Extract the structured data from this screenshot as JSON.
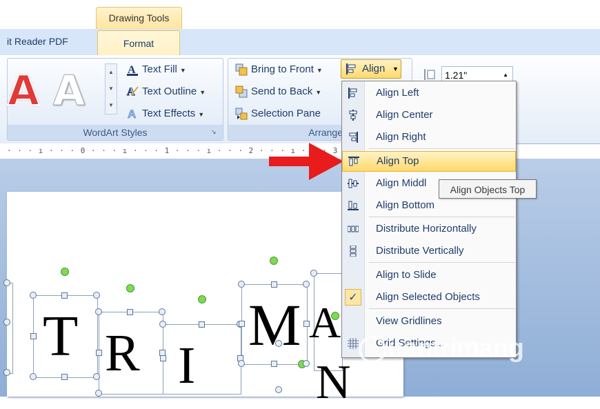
{
  "ribbon": {
    "contextual_tab": "Drawing Tools",
    "tabs": [
      "it Reader PDF",
      "Format"
    ],
    "wordart_group": {
      "label": "WordArt Styles",
      "items": [
        "Text Fill",
        "Text Outline",
        "Text Effects"
      ]
    },
    "arrange_group": {
      "label": "Arrange",
      "items": [
        "Bring to Front",
        "Send to Back",
        "Selection Pane"
      ],
      "align_button": "Align"
    },
    "size_value": "1.21\""
  },
  "ruler_text": "· · · ı · · · 0 · · · ı · · · 1 · · · ı · · · 2 · · · ı · · · 3",
  "letters": [
    "T",
    "R",
    "I",
    "M",
    "A",
    "N"
  ],
  "align_menu": {
    "items": [
      {
        "label": "Align Left",
        "icon": "align-left-icon"
      },
      {
        "label": "Align Center",
        "icon": "align-center-icon"
      },
      {
        "label": "Align Right",
        "icon": "align-right-icon"
      },
      {
        "label": "Align Top",
        "icon": "align-top-icon",
        "highlighted": true
      },
      {
        "label": "Align Middle",
        "icon": "align-middle-icon"
      },
      {
        "label": "Align Bottom",
        "icon": "align-bottom-icon"
      },
      {
        "label": "Distribute Horizontally",
        "icon": "distribute-horizontally-icon"
      },
      {
        "label": "Distribute Vertically",
        "icon": "distribute-vertically-icon"
      },
      {
        "label": "Align to Slide",
        "icon": ""
      },
      {
        "label": "Align Selected Objects",
        "icon": "checkmark-icon",
        "checked": true
      },
      {
        "label": "View Gridlines",
        "icon": ""
      },
      {
        "label": "Grid Settings...",
        "icon": "grid-icon"
      }
    ],
    "shown_labels": [
      "Align Left",
      "Align Center",
      "Align Right",
      "Align Top",
      "Align Middl",
      "Align Bottom",
      "Distribute Horizontally",
      "Distribute Vertically",
      "Align to Slide",
      "Align Selected Objects",
      "View Gridlines",
      "Grid Settings..."
    ]
  },
  "tooltip": "Align Objects Top",
  "watermark": "uantrimang",
  "colors": {
    "highlight": "#ffd96b",
    "arrow": "#e81c1c",
    "ribbon": "#d7e6f8"
  }
}
